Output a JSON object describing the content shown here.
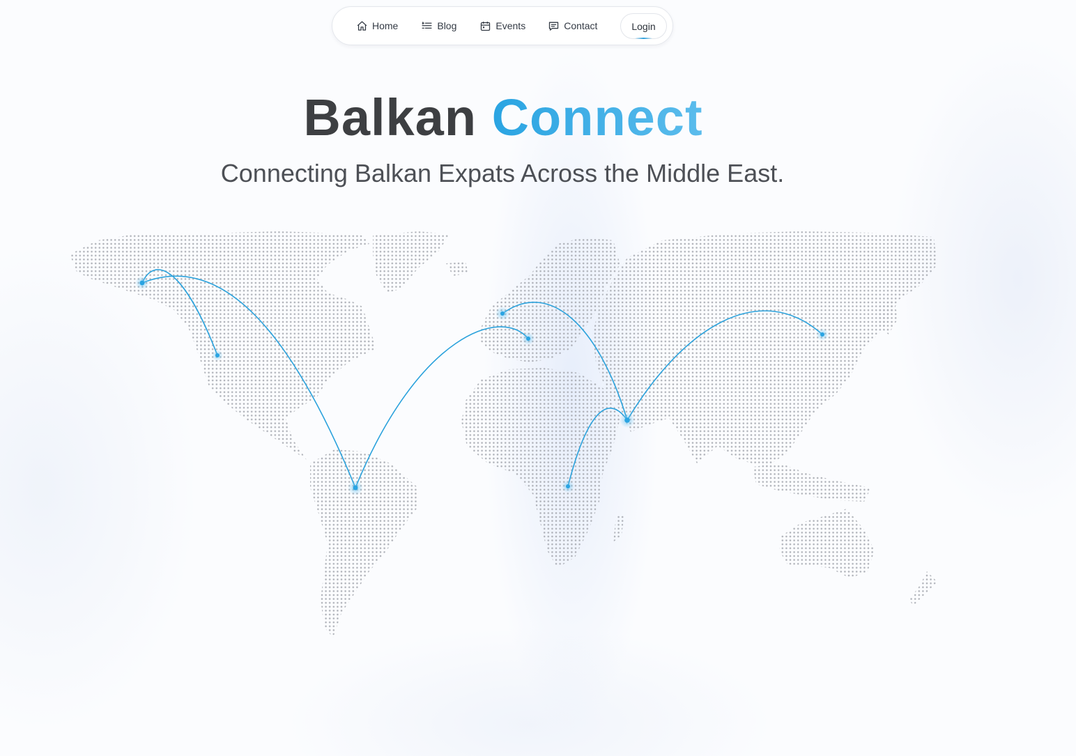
{
  "nav": {
    "items": [
      {
        "label": "Home",
        "icon": "home-icon"
      },
      {
        "label": "Blog",
        "icon": "blog-icon"
      },
      {
        "label": "Events",
        "icon": "calendar-icon"
      },
      {
        "label": "Contact",
        "icon": "chat-icon"
      }
    ],
    "login_label": "Login"
  },
  "hero": {
    "title_part1": "Balkan",
    "title_part2": "Connect",
    "subtitle": "Connecting Balkan Expats Across the Middle East."
  },
  "colors": {
    "accent": "#2aa4e2",
    "title_dark": "#3d3f42",
    "map_dot": "#a9acb2"
  }
}
